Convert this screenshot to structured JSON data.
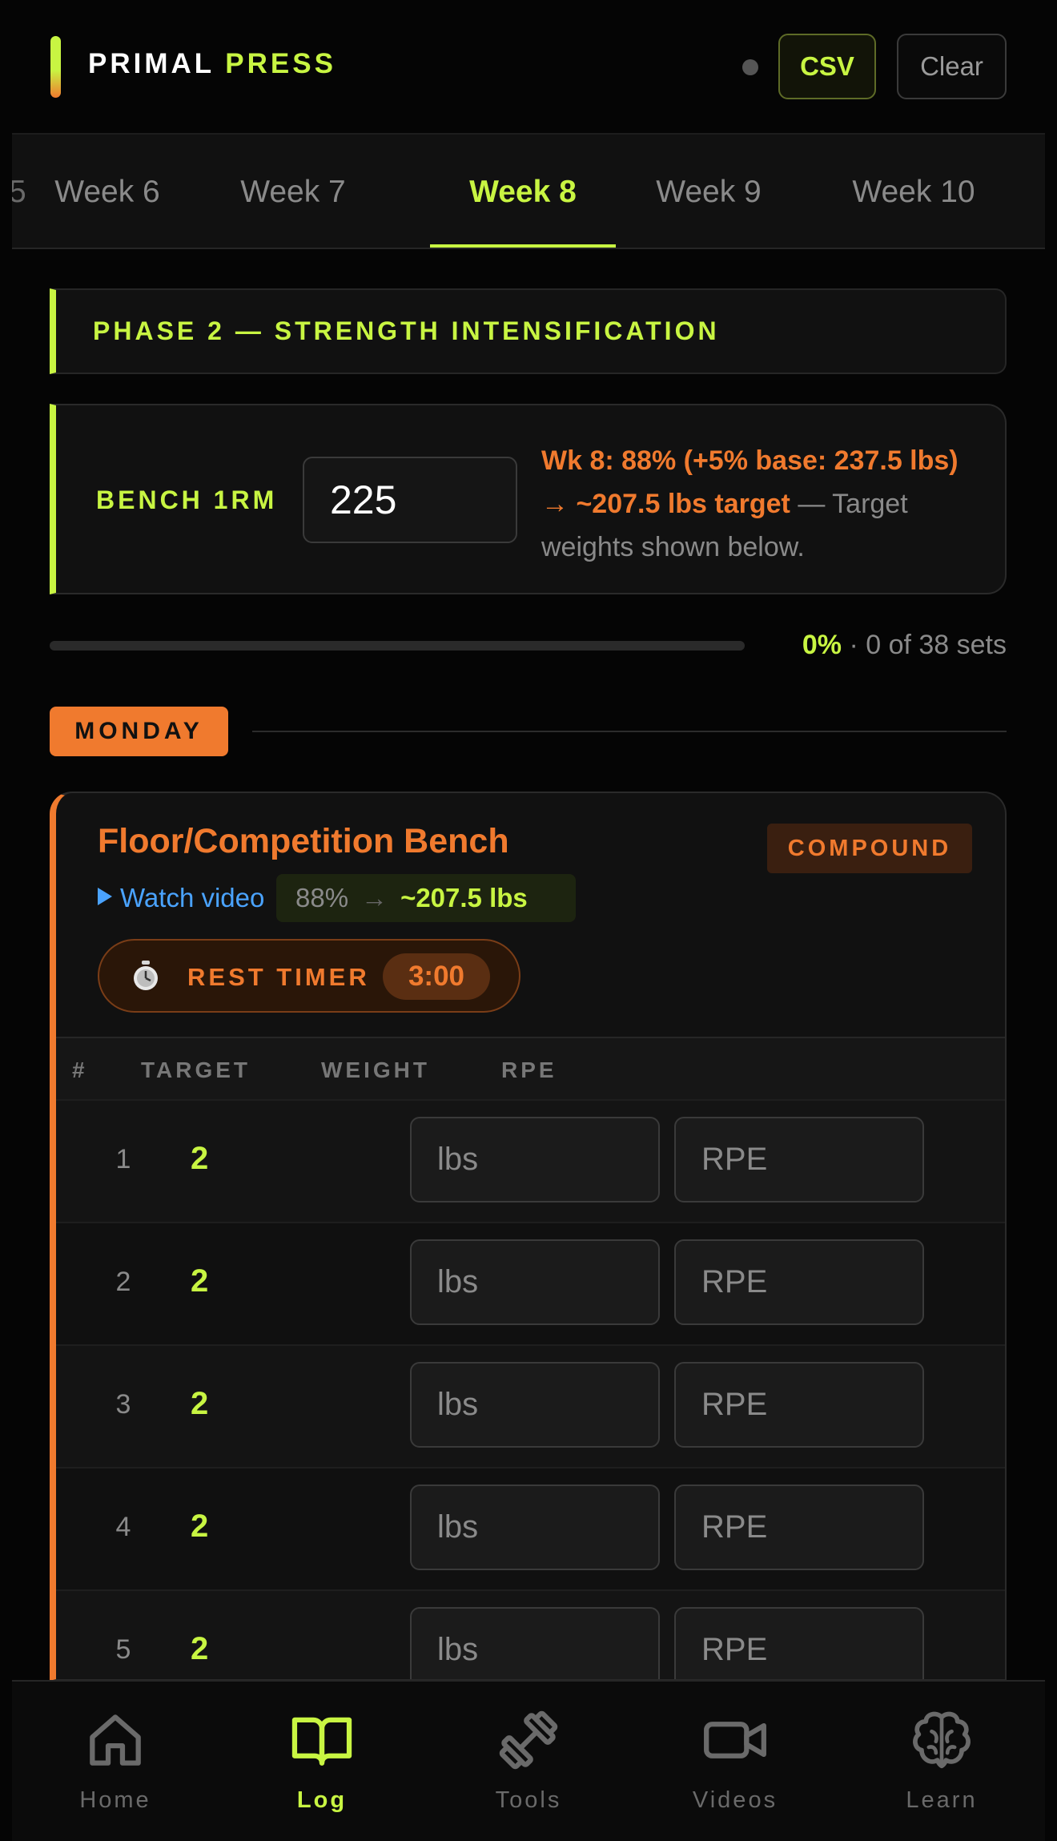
{
  "app": {
    "brand_primary": "PRIMAL",
    "brand_accent": "PRESS",
    "csv_label": "CSV",
    "clear_label": "Clear"
  },
  "colors": {
    "lime": "#c8f542",
    "orange": "#f07a2e",
    "link": "#4aa3ff",
    "background": "#050505"
  },
  "weeks": {
    "left_edge": "5",
    "tabs": [
      "Week 6",
      "Week 7",
      "Week 8",
      "Week 9",
      "Week 10"
    ],
    "active": "Week 8"
  },
  "phase": {
    "title": "PHASE 2 — STRENGTH INTENSIFICATION"
  },
  "one_rm": {
    "label": "BENCH 1RM",
    "value": "225",
    "info_highlight": "Wk 8: 88% (+5% base: 237.5 lbs) → ~207.5 lbs target",
    "info_dash": " — ",
    "info_rest": "Target weights shown below."
  },
  "progress": {
    "percent_label": "0%",
    "separator": " · ",
    "detail": "0 of 38 sets",
    "fraction": 0
  },
  "day": {
    "label": "MONDAY"
  },
  "exercise": {
    "name": "Floor/Competition Bench",
    "tag": "COMPOUND",
    "video_label": "Watch video",
    "percent": "88%",
    "arrow": "→",
    "target_weight": "~207.5 lbs",
    "rest_label": "REST TIMER",
    "rest_time": "3:00",
    "columns": [
      "#",
      "TARGET",
      "WEIGHT",
      "RPE"
    ],
    "sets": [
      {
        "num": "1",
        "target": "2",
        "weight_placeholder": "lbs",
        "rpe_placeholder": "RPE"
      },
      {
        "num": "2",
        "target": "2",
        "weight_placeholder": "lbs",
        "rpe_placeholder": "RPE"
      },
      {
        "num": "3",
        "target": "2",
        "weight_placeholder": "lbs",
        "rpe_placeholder": "RPE"
      },
      {
        "num": "4",
        "target": "2",
        "weight_placeholder": "lbs",
        "rpe_placeholder": "RPE"
      },
      {
        "num": "5",
        "target": "2",
        "weight_placeholder": "lbs",
        "rpe_placeholder": "RPE"
      }
    ]
  },
  "nav": {
    "items": [
      {
        "label": "Home",
        "icon": "home-icon"
      },
      {
        "label": "Log",
        "icon": "book-icon"
      },
      {
        "label": "Tools",
        "icon": "dumbbell-icon"
      },
      {
        "label": "Videos",
        "icon": "video-camera-icon"
      },
      {
        "label": "Learn",
        "icon": "brain-icon"
      }
    ],
    "active": "Log"
  }
}
